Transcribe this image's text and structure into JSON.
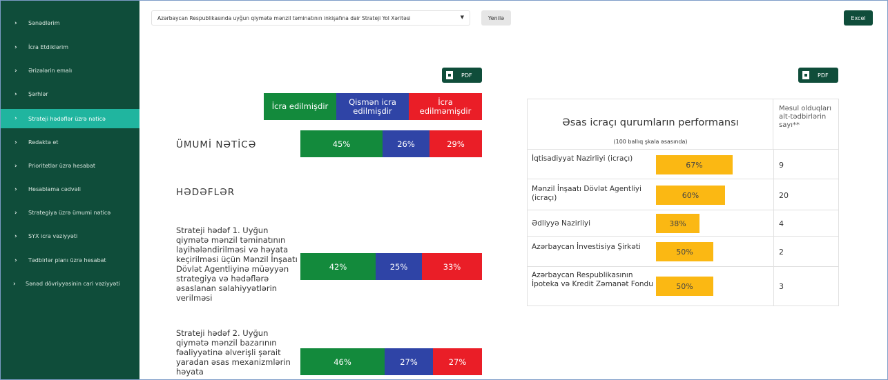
{
  "sidebar": {
    "items": [
      {
        "label": "Sənədlərim"
      },
      {
        "label": "İcra Etdiklərim"
      },
      {
        "label": "Ərizələrin emalı"
      },
      {
        "label": "Şərhlər"
      },
      {
        "label": "Strateji hədəflər üzrə nəticə"
      },
      {
        "label": "Redaktə et"
      },
      {
        "label": "Prioritetlər üzrə hesabat"
      },
      {
        "label": "Hesablama cədvəli"
      },
      {
        "label": "Strategiya üzrə ümumi nəticə"
      },
      {
        "label": "SYX icra vəziyyəti"
      },
      {
        "label": "Tədbirlər planı üzrə hesabat"
      },
      {
        "label": "Sənəd dövriyyəsinin cari vəziyyəti"
      }
    ],
    "active_index": 4
  },
  "toolbar": {
    "select_value": "Azərbaycan Respublikasında uyğun qiymətə mənzil təminatının inkişafına dair Strateji Yol Xəritəsi",
    "select_arrow": "▼",
    "reset_label": "Yenilə",
    "excel_label": "Excel",
    "pdf_label": "PDF"
  },
  "legend": {
    "done": "İcra edilmişdir",
    "partial": "Qismən icra edilmişdir",
    "not_done": "İcra edilməmişdir"
  },
  "overall": {
    "label": "ÜMUMİ NƏTİCƏ",
    "done": "45%",
    "partial": "26%",
    "not_done": "29%"
  },
  "goals_heading": "HƏDƏFLƏR",
  "goals": [
    {
      "text": "Strateji hədəf 1. Uyğun qiymətə mənzil təminatının layihələndirilməsi və həyata keçirilməsi üçün Mənzil İnşaatı Dövlət Agentliyinə müəyyən strategiya və hədəflərə əsaslanan səlahiyyətlərin verilməsi",
      "done": "42%",
      "partial": "25%",
      "not_done": "33%"
    },
    {
      "text": "Strateji hədəf 2. Uyğun qiymətə mənzil bazarının fəaliyyətinə əlverişli şərait yaradan əsas mexanizmlərin həyata",
      "done": "46%",
      "partial": "27%",
      "not_done": "27%"
    }
  ],
  "performance": {
    "title": "Əsas icraçı qurumların performansı",
    "subtitle": "(100 ballıq şkala əsasında)",
    "count_header": "Məsul olduqları alt-tədbirlərin sayı**",
    "rows": [
      {
        "name": "İqtisadiyyat Nazirliyi (icraçı)",
        "score": "67%",
        "score_value": 67,
        "count": "9"
      },
      {
        "name": "Mənzil İnşaatı Dövlət Agentliyi (icraçı)",
        "score": "60%",
        "score_value": 60,
        "count": "20"
      },
      {
        "name": "Ədliyyə Nazirliyi",
        "score": "38%",
        "score_value": 38,
        "count": "4"
      },
      {
        "name": "Azərbaycan İnvestisiya Şirkəti",
        "score": "50%",
        "score_value": 50,
        "count": "2"
      },
      {
        "name": "Azərbaycan Respublikasının İpoteka və Kredit Zəmanət Fondu",
        "score": "50%",
        "score_value": 50,
        "count": "3"
      }
    ]
  },
  "colors": {
    "sidebar_bg": "#0f4d3a",
    "sidebar_active": "#20b59f",
    "done": "#138a3c",
    "partial": "#2f44a6",
    "not_done": "#ea1e27",
    "score_bar": "#fbb813"
  }
}
